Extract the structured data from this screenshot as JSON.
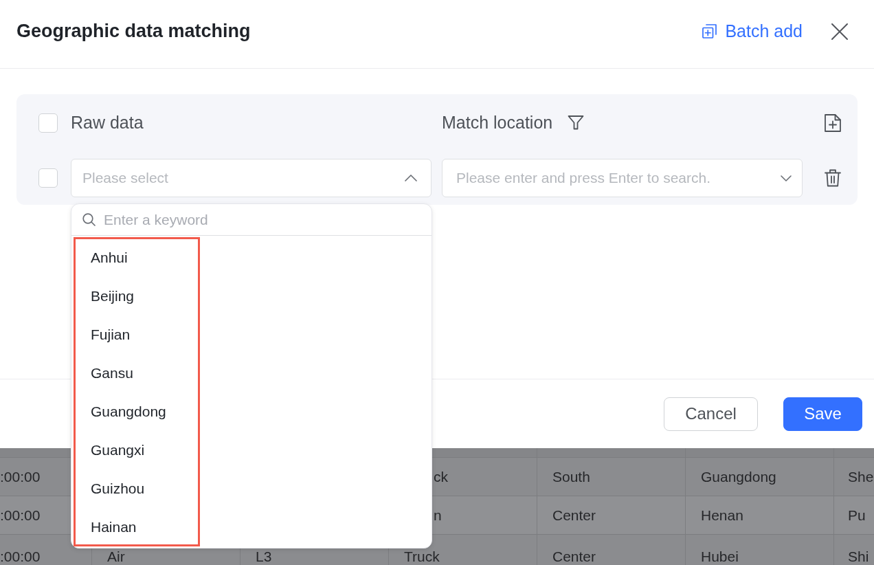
{
  "dialog": {
    "title": "Geographic data matching",
    "batch_add": "Batch add"
  },
  "mapping_panel": {
    "header": {
      "checked": false,
      "raw_data_label": "Raw data",
      "match_location_label": "Match location"
    },
    "rows": [
      {
        "checked": false,
        "raw_data": {
          "placeholder": "Please select",
          "expanded": true
        },
        "match_location": {
          "placeholder": "Please enter and press Enter to search."
        }
      }
    ]
  },
  "dropdown": {
    "search": {
      "placeholder": "Enter a keyword"
    },
    "options_highlighted": true,
    "options": [
      {
        "label": "Anhui",
        "selected": false
      },
      {
        "label": "Beijing",
        "selected": false
      },
      {
        "label": "Fujian",
        "selected": false
      },
      {
        "label": "Gansu",
        "selected": false
      },
      {
        "label": "Guangdong",
        "selected": false
      },
      {
        "label": "Guangxi",
        "selected": false
      },
      {
        "label": "Guizhou",
        "selected": false
      },
      {
        "label": "Hainan",
        "selected": false
      }
    ]
  },
  "footer": {
    "buttons": [
      {
        "label": "Cancel",
        "kind": "secondary"
      },
      {
        "label": "Save",
        "kind": "primary"
      }
    ]
  },
  "background_table": {
    "rows": [
      {
        "column_1": ":00:00",
        "column_4": "ck",
        "column_5": "South",
        "column_6": "Guangdong",
        "column_7": "She"
      },
      {
        "column_1": ":00:00",
        "column_4": "n",
        "column_5": "Center",
        "column_6": "Henan",
        "column_7": "Pu"
      },
      {
        "column_1": ":00:00",
        "column_2": "Air",
        "column_3": "L3",
        "column_4": "Truck",
        "column_5": "Center",
        "column_6": "Hubei",
        "column_7": "Shi"
      }
    ]
  }
}
